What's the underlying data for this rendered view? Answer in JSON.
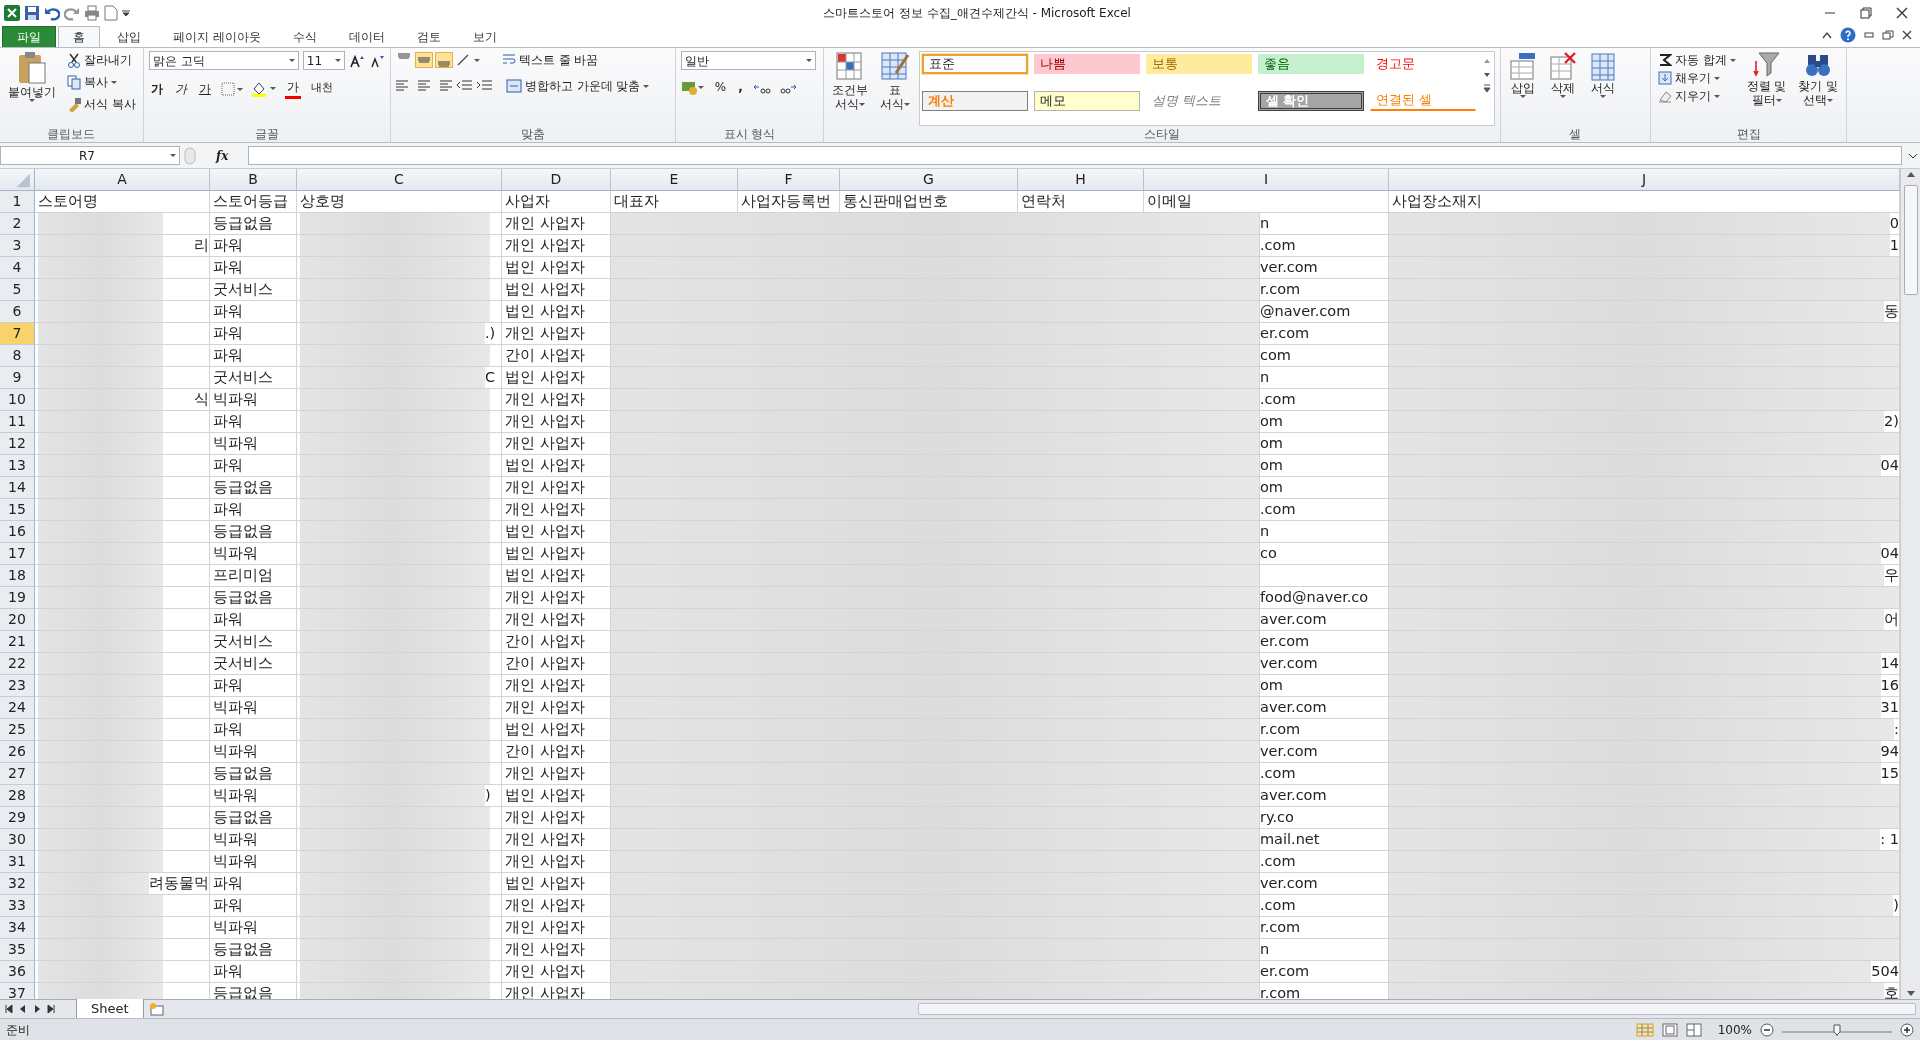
{
  "window": {
    "title": "스마트스토어 정보 수집_애견수제간식 - Microsoft Excel"
  },
  "ribbon_tabs": [
    {
      "label": "파일",
      "kind": "file",
      "selected": false
    },
    {
      "label": "홈",
      "kind": "tab",
      "selected": true
    },
    {
      "label": "삽입",
      "kind": "tab",
      "selected": false
    },
    {
      "label": "페이지 레이아웃",
      "kind": "tab",
      "selected": false
    },
    {
      "label": "수식",
      "kind": "tab",
      "selected": false
    },
    {
      "label": "데이터",
      "kind": "tab",
      "selected": false
    },
    {
      "label": "검토",
      "kind": "tab",
      "selected": false
    },
    {
      "label": "보기",
      "kind": "tab",
      "selected": false
    }
  ],
  "ribbon": {
    "clipboard": {
      "label": "클립보드",
      "paste": "붙여넣기",
      "items": [
        "잘라내기",
        "복사",
        "서식 복사"
      ]
    },
    "font": {
      "label": "글꼴",
      "font_name": "맑은 고딕",
      "font_size": "11",
      "style_buttons": [
        "가",
        "가",
        "가"
      ],
      "font_color": "가",
      "phonetic": "내천"
    },
    "alignment": {
      "label": "맞춤",
      "vertical": [
        {
          "selected": false
        },
        {
          "selected": true
        },
        {
          "selected": true
        }
      ],
      "wrap": "텍스트 줄 바꿈",
      "merge": "병합하고 가운데 맞춤"
    },
    "number": {
      "label": "표시 형식",
      "format": "일반",
      "percent": "%",
      "comma": ","
    },
    "styles": {
      "label": "스타일",
      "conditional": [
        "조건부",
        "서식"
      ],
      "table": [
        "표",
        "서식"
      ],
      "cell_styles": [
        {
          "label": "표준",
          "kind": "normal",
          "selected": true
        },
        {
          "label": "나쁨",
          "kind": "bad",
          "selected": false
        },
        {
          "label": "보통",
          "kind": "neutral",
          "selected": false
        },
        {
          "label": "좋음",
          "kind": "good",
          "selected": false
        },
        {
          "label": "경고문",
          "kind": "warning",
          "selected": false
        },
        {
          "label": "계산",
          "kind": "calc",
          "selected": false
        },
        {
          "label": "메모",
          "kind": "note",
          "selected": false
        },
        {
          "label": "설명 텍스트",
          "kind": "explain",
          "selected": false
        },
        {
          "label": "셀 확인",
          "kind": "check",
          "selected": false
        },
        {
          "label": "연결된 셀",
          "kind": "linked",
          "selected": false
        }
      ]
    },
    "cells": {
      "label": "셀",
      "buttons": [
        "삽입",
        "삭제",
        "서식"
      ]
    },
    "editing": {
      "label": "편집",
      "items": [
        "자동 합계",
        "채우기",
        "지우기"
      ],
      "sort": [
        "정렬 및",
        "필터"
      ],
      "find": [
        "찾기 및",
        "선택"
      ]
    }
  },
  "formula_bar": {
    "name_box": "R7",
    "fx": "fx"
  },
  "sheet": {
    "columns": [
      "A",
      "B",
      "C",
      "D",
      "E",
      "F",
      "G",
      "H",
      "I",
      "J"
    ],
    "header": {
      "num": "1",
      "selected": false,
      "cells": [
        "스토어명",
        "스토어등급",
        "상호명",
        "사업자",
        "대표자",
        "사업자등록번",
        "통신판매업번호",
        "연락처",
        "이메일",
        "사업장소재지"
      ]
    },
    "rows": [
      {
        "num": "2",
        "selected": false,
        "grade": "등급없음",
        "type": "개인 사업자",
        "email_tail": "n",
        "j_tail": "0"
      },
      {
        "num": "3",
        "selected": false,
        "a_tail": "리",
        "grade": "파워",
        "type": "개인 사업자",
        "email_tail": ".com",
        "j_tail": "1"
      },
      {
        "num": "4",
        "selected": false,
        "grade": "파워",
        "type": "법인 사업자",
        "email_tail": "ver.com"
      },
      {
        "num": "5",
        "selected": false,
        "grade": "굿서비스",
        "type": "법인 사업자",
        "email_tail": "r.com"
      },
      {
        "num": "6",
        "selected": false,
        "grade": "파워",
        "type": "법인 사업자",
        "email_tail": "@naver.com",
        "j_tail": "동"
      },
      {
        "num": "7",
        "selected": true,
        "grade": "파워",
        "c_tail": ".)",
        "type": "개인 사업자",
        "email_tail": "er.com"
      },
      {
        "num": "8",
        "selected": false,
        "grade": "파워",
        "type": "간이 사업자",
        "email_tail": "com"
      },
      {
        "num": "9",
        "selected": false,
        "grade": "굿서비스",
        "c_tail": "C",
        "type": "법인 사업자",
        "email_tail": "n"
      },
      {
        "num": "10",
        "selected": false,
        "a_tail": "식",
        "grade": "빅파워",
        "type": "개인 사업자",
        "email_tail": ".com"
      },
      {
        "num": "11",
        "selected": false,
        "grade": "파워",
        "type": "개인 사업자",
        "email_tail": "om",
        "j_tail": "2)"
      },
      {
        "num": "12",
        "selected": false,
        "grade": "빅파워",
        "type": "개인 사업자",
        "email_tail": "om"
      },
      {
        "num": "13",
        "selected": false,
        "grade": "파워",
        "type": "법인 사업자",
        "email_tail": "om",
        "j_tail": "04"
      },
      {
        "num": "14",
        "selected": false,
        "grade": "등급없음",
        "type": "개인 사업자",
        "email_tail": "om"
      },
      {
        "num": "15",
        "selected": false,
        "grade": "파워",
        "type": "개인 사업자",
        "email_tail": ".com"
      },
      {
        "num": "16",
        "selected": false,
        "grade": "등급없음",
        "type": "법인 사업자",
        "email_tail": "n"
      },
      {
        "num": "17",
        "selected": false,
        "grade": "빅파워",
        "type": "법인 사업자",
        "email_tail": "co",
        "j_tail": "04"
      },
      {
        "num": "18",
        "selected": false,
        "grade": "프리미엄",
        "type": "법인 사업자",
        "j_tail": "우"
      },
      {
        "num": "19",
        "selected": false,
        "grade": "등급없음",
        "type": "개인 사업자",
        "email_tail": "food@naver.co"
      },
      {
        "num": "20",
        "selected": false,
        "grade": "파워",
        "type": "개인 사업자",
        "email_tail": "aver.com",
        "j_tail": "어"
      },
      {
        "num": "21",
        "selected": false,
        "grade": "굿서비스",
        "type": "간이 사업자",
        "email_tail": "er.com"
      },
      {
        "num": "22",
        "selected": false,
        "grade": "굿서비스",
        "type": "간이 사업자",
        "email_tail": "ver.com",
        "j_tail": "14"
      },
      {
        "num": "23",
        "selected": false,
        "grade": "파워",
        "type": "개인 사업자",
        "email_tail": "om",
        "j_tail": "16"
      },
      {
        "num": "24",
        "selected": false,
        "grade": "빅파워",
        "type": "개인 사업자",
        "email_tail": "aver.com",
        "j_tail": "31"
      },
      {
        "num": "25",
        "selected": false,
        "grade": "파워",
        "type": "법인 사업자",
        "email_tail": "r.com",
        "j_tail": ":"
      },
      {
        "num": "26",
        "selected": false,
        "grade": "빅파워",
        "type": "간이 사업자",
        "email_tail": "ver.com",
        "j_tail": "94"
      },
      {
        "num": "27",
        "selected": false,
        "grade": "등급없음",
        "type": "개인 사업자",
        "email_tail": ".com",
        "j_tail": "15"
      },
      {
        "num": "28",
        "selected": false,
        "grade": "빅파워",
        "c_tail": ")",
        "type": "법인 사업자",
        "email_tail": "aver.com"
      },
      {
        "num": "29",
        "selected": false,
        "grade": "등급없음",
        "type": "개인 사업자",
        "email_tail": "ry.co"
      },
      {
        "num": "30",
        "selected": false,
        "grade": "빅파워",
        "type": "개인 사업자",
        "email_tail": "mail.net",
        "j_tail": ": 1"
      },
      {
        "num": "31",
        "selected": false,
        "grade": "빅파워",
        "type": "개인 사업자",
        "email_tail": ".com"
      },
      {
        "num": "32",
        "selected": false,
        "a_tail": "려동물먹",
        "grade": "파워",
        "type": "법인 사업자",
        "email_tail": "ver.com"
      },
      {
        "num": "33",
        "selected": false,
        "grade": "파워",
        "type": "개인 사업자",
        "email_tail": ".com",
        "j_tail": ")"
      },
      {
        "num": "34",
        "selected": false,
        "grade": "빅파워",
        "type": "개인 사업자",
        "email_tail": "r.com"
      },
      {
        "num": "35",
        "selected": false,
        "grade": "등급없음",
        "type": "개인 사업자",
        "email_tail": "n"
      },
      {
        "num": "36",
        "selected": false,
        "grade": "파워",
        "type": "개인 사업자",
        "email_tail": "er.com",
        "j_tail": "504"
      },
      {
        "num": "37",
        "selected": false,
        "grade": "등급없음",
        "type": "개인 사업자",
        "email_tail": "r.com",
        "j_tail": "호"
      }
    ]
  },
  "sheet_tabs": [
    {
      "label": "Sheet",
      "selected": true
    }
  ],
  "status_bar": {
    "status": "준비",
    "zoom": "100%"
  }
}
